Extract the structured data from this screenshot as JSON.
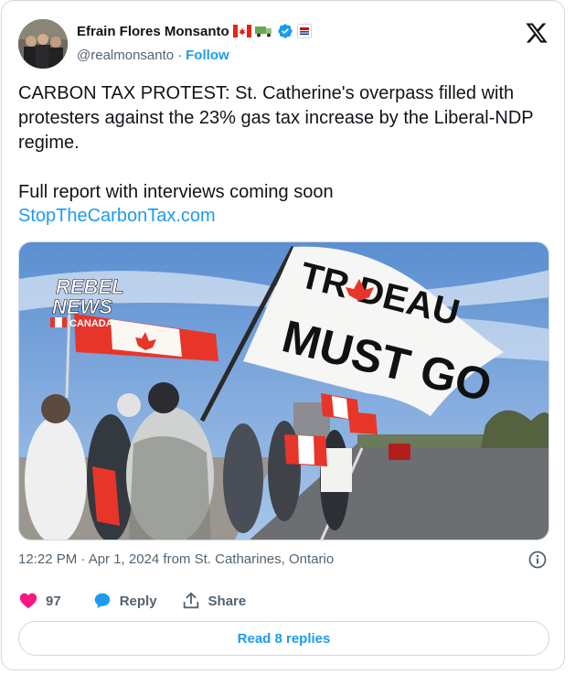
{
  "author": {
    "name": "Efrain Flores Monsanto",
    "handle": "@realmonsanto",
    "follow_label": "Follow",
    "separator": "·"
  },
  "tweet": {
    "text": "CARBON TAX PROTEST: St. Catherine's overpass filled with protesters against the 23% gas tax increase by the Liberal-NDP regime.\n\nFull report with interviews coming soon",
    "link": "StopTheCarbonTax.com"
  },
  "media": {
    "watermark_line1": "REBEL",
    "watermark_line2": "NEWS",
    "watermark_line3": "CANADA",
    "flag_text_line1": "TR  DEAU",
    "flag_text_line2": "MUST GO"
  },
  "meta": {
    "timestamp": "12:22 PM · Apr 1, 2024 from St. Catharines, Ontario"
  },
  "actions": {
    "like_count": "97",
    "reply_label": "Reply",
    "share_label": "Share"
  },
  "read_replies_label": "Read 8 replies",
  "colors": {
    "accent": "#1d9bf0",
    "like": "#f91880",
    "muted": "#536471"
  }
}
